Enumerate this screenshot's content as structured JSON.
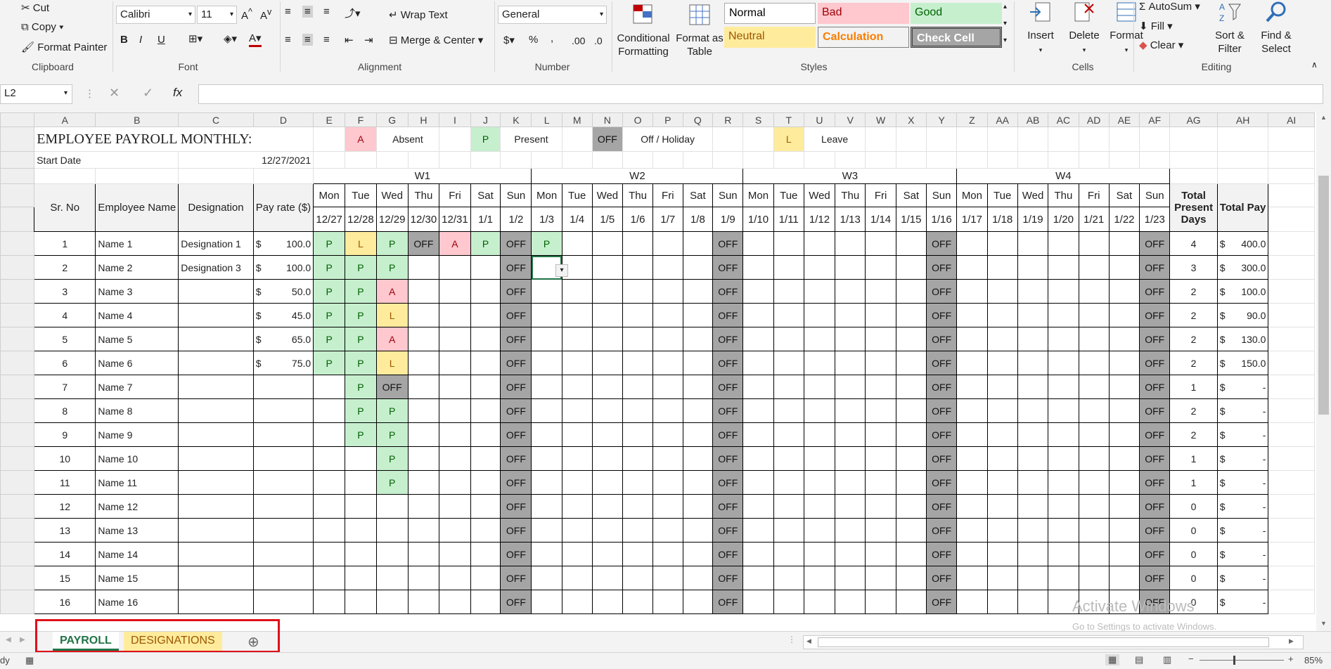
{
  "ribbon": {
    "clipboard": {
      "cut": "Cut",
      "copy": "Copy",
      "format_painter": "Format Painter",
      "label": "Clipboard"
    },
    "font": {
      "name": "Calibri",
      "size": "11",
      "label": "Font",
      "bold": "B",
      "italic": "I",
      "underline": "U"
    },
    "alignment": {
      "wrap_text": "Wrap Text",
      "merge_center": "Merge & Center",
      "label": "Alignment"
    },
    "number": {
      "format": "General",
      "label": "Number",
      "currency": "$",
      "percent": "%",
      "comma": ","
    },
    "styles": {
      "conditional_formatting": "Conditional Formatting",
      "format_as_table": "Format as Table",
      "cells": [
        {
          "name": "Normal"
        },
        {
          "name": "Bad"
        },
        {
          "name": "Good"
        },
        {
          "name": "Neutral"
        },
        {
          "name": "Calculation"
        },
        {
          "name": "Check Cell"
        }
      ],
      "label": "Styles"
    },
    "cells": {
      "insert": "Insert",
      "delete": "Delete",
      "format": "Format",
      "label": "Cells"
    },
    "editing": {
      "autosum": "AutoSum",
      "fill": "Fill",
      "clear": "Clear",
      "sort_filter": "Sort & Filter",
      "find_select": "Find & Select",
      "label": "Editing"
    }
  },
  "formula_bar": {
    "name_box": "L2",
    "formula": ""
  },
  "columns": [
    "A",
    "B",
    "C",
    "D",
    "E",
    "F",
    "G",
    "H",
    "I",
    "J",
    "K",
    "L",
    "M",
    "N",
    "O",
    "P",
    "Q",
    "R",
    "S",
    "T",
    "U",
    "V",
    "W",
    "X",
    "Y",
    "Z",
    "AA",
    "AB",
    "AC",
    "AD",
    "AE",
    "AF",
    "AG",
    "AH",
    "AI"
  ],
  "sheet": {
    "title": "EMPLOYEE PAYROLL MONTHLY:",
    "start_date_label": "Start Date",
    "start_date": "12/27/2021",
    "legend": [
      {
        "code": "A",
        "label": "Absent"
      },
      {
        "code": "P",
        "label": "Present"
      },
      {
        "code": "OFF",
        "label": "Off / Holiday"
      },
      {
        "code": "L",
        "label": "Leave"
      }
    ],
    "weeks": [
      "W1",
      "W2",
      "W3",
      "W4"
    ],
    "headers": {
      "sr": "Sr. No",
      "name": "Employee Name",
      "designation": "Designation",
      "pay_rate": "Pay rate ($)",
      "total_days": "Total Present Days",
      "total_pay": "Total Pay"
    },
    "days": [
      "Mon",
      "Tue",
      "Wed",
      "Thu",
      "Fri",
      "Sat",
      "Sun",
      "Mon",
      "Tue",
      "Wed",
      "Thu",
      "Fri",
      "Sat",
      "Sun",
      "Mon",
      "Tue",
      "Wed",
      "Thu",
      "Fri",
      "Sat",
      "Sun",
      "Mon",
      "Tue",
      "Wed",
      "Thu",
      "Fri",
      "Sat",
      "Sun"
    ],
    "dates": [
      "12/27",
      "12/28",
      "12/29",
      "12/30",
      "12/31",
      "1/1",
      "1/2",
      "1/3",
      "1/4",
      "1/5",
      "1/6",
      "1/7",
      "1/8",
      "1/9",
      "1/10",
      "1/11",
      "1/12",
      "1/13",
      "1/14",
      "1/15",
      "1/16",
      "1/17",
      "1/18",
      "1/19",
      "1/20",
      "1/21",
      "1/22",
      "1/23"
    ],
    "employees": [
      {
        "sr": "1",
        "name": "Name 1",
        "designation": "Designation 1",
        "rate": "100.0",
        "att": [
          "P",
          "L",
          "P",
          "OFF",
          "A",
          "P",
          "OFF",
          "P"
        ],
        "days": "4",
        "pay": "400.0"
      },
      {
        "sr": "2",
        "name": "Name 2",
        "designation": "Designation 3",
        "rate": "100.0",
        "att": [
          "P",
          "P",
          "P",
          "",
          "",
          "",
          "OFF"
        ],
        "days": "3",
        "pay": "300.0"
      },
      {
        "sr": "3",
        "name": "Name 3",
        "designation": "",
        "rate": "50.0",
        "att": [
          "P",
          "P",
          "A",
          "",
          "",
          "",
          "OFF"
        ],
        "days": "2",
        "pay": "100.0"
      },
      {
        "sr": "4",
        "name": "Name 4",
        "designation": "",
        "rate": "45.0",
        "att": [
          "P",
          "P",
          "L",
          "",
          "",
          "",
          "OFF"
        ],
        "days": "2",
        "pay": "90.0"
      },
      {
        "sr": "5",
        "name": "Name 5",
        "designation": "",
        "rate": "65.0",
        "att": [
          "P",
          "P",
          "A",
          "",
          "",
          "",
          "OFF"
        ],
        "days": "2",
        "pay": "130.0"
      },
      {
        "sr": "6",
        "name": "Name 6",
        "designation": "",
        "rate": "75.0",
        "att": [
          "P",
          "P",
          "L",
          "",
          "",
          "",
          "OFF"
        ],
        "days": "2",
        "pay": "150.0"
      },
      {
        "sr": "7",
        "name": "Name 7",
        "designation": "",
        "rate": "",
        "att": [
          "",
          "P",
          "OFF",
          "",
          "",
          "",
          "OFF"
        ],
        "days": "1",
        "pay": "-"
      },
      {
        "sr": "8",
        "name": "Name 8",
        "designation": "",
        "rate": "",
        "att": [
          "",
          "P",
          "P",
          "",
          "",
          "",
          "OFF"
        ],
        "days": "2",
        "pay": "-"
      },
      {
        "sr": "9",
        "name": "Name 9",
        "designation": "",
        "rate": "",
        "att": [
          "",
          "P",
          "P",
          "",
          "",
          "",
          "OFF"
        ],
        "days": "2",
        "pay": "-"
      },
      {
        "sr": "10",
        "name": "Name 10",
        "designation": "",
        "rate": "",
        "att": [
          "",
          "",
          "P",
          "",
          "",
          "",
          "OFF"
        ],
        "days": "1",
        "pay": "-"
      },
      {
        "sr": "11",
        "name": "Name 11",
        "designation": "",
        "rate": "",
        "att": [
          "",
          "",
          "P",
          "",
          "",
          "",
          "OFF"
        ],
        "days": "1",
        "pay": "-"
      },
      {
        "sr": "12",
        "name": "Name 12",
        "designation": "",
        "rate": "",
        "att": [
          "",
          "",
          "",
          "",
          "",
          "",
          "OFF"
        ],
        "days": "0",
        "pay": "-"
      },
      {
        "sr": "13",
        "name": "Name 13",
        "designation": "",
        "rate": "",
        "att": [
          "",
          "",
          "",
          "",
          "",
          "",
          "OFF"
        ],
        "days": "0",
        "pay": "-"
      },
      {
        "sr": "14",
        "name": "Name 14",
        "designation": "",
        "rate": "",
        "att": [
          "",
          "",
          "",
          "",
          "",
          "",
          "OFF"
        ],
        "days": "0",
        "pay": "-"
      },
      {
        "sr": "15",
        "name": "Name 15",
        "designation": "",
        "rate": "",
        "att": [
          "",
          "",
          "",
          "",
          "",
          "",
          "OFF"
        ],
        "days": "0",
        "pay": "-"
      },
      {
        "sr": "16",
        "name": "Name 16",
        "designation": "",
        "rate": "",
        "att": [
          "",
          "",
          "",
          "",
          "",
          "",
          "OFF"
        ],
        "days": "0",
        "pay": "-"
      }
    ]
  },
  "tabs": [
    {
      "label": "PAYROLL",
      "active": true
    },
    {
      "label": "DESIGNATIONS",
      "active": false
    }
  ],
  "status": {
    "left": "dy",
    "zoom": "85%"
  },
  "watermark": {
    "line1": "Activate Windows",
    "line2": "Go to Settings to activate Windows."
  }
}
